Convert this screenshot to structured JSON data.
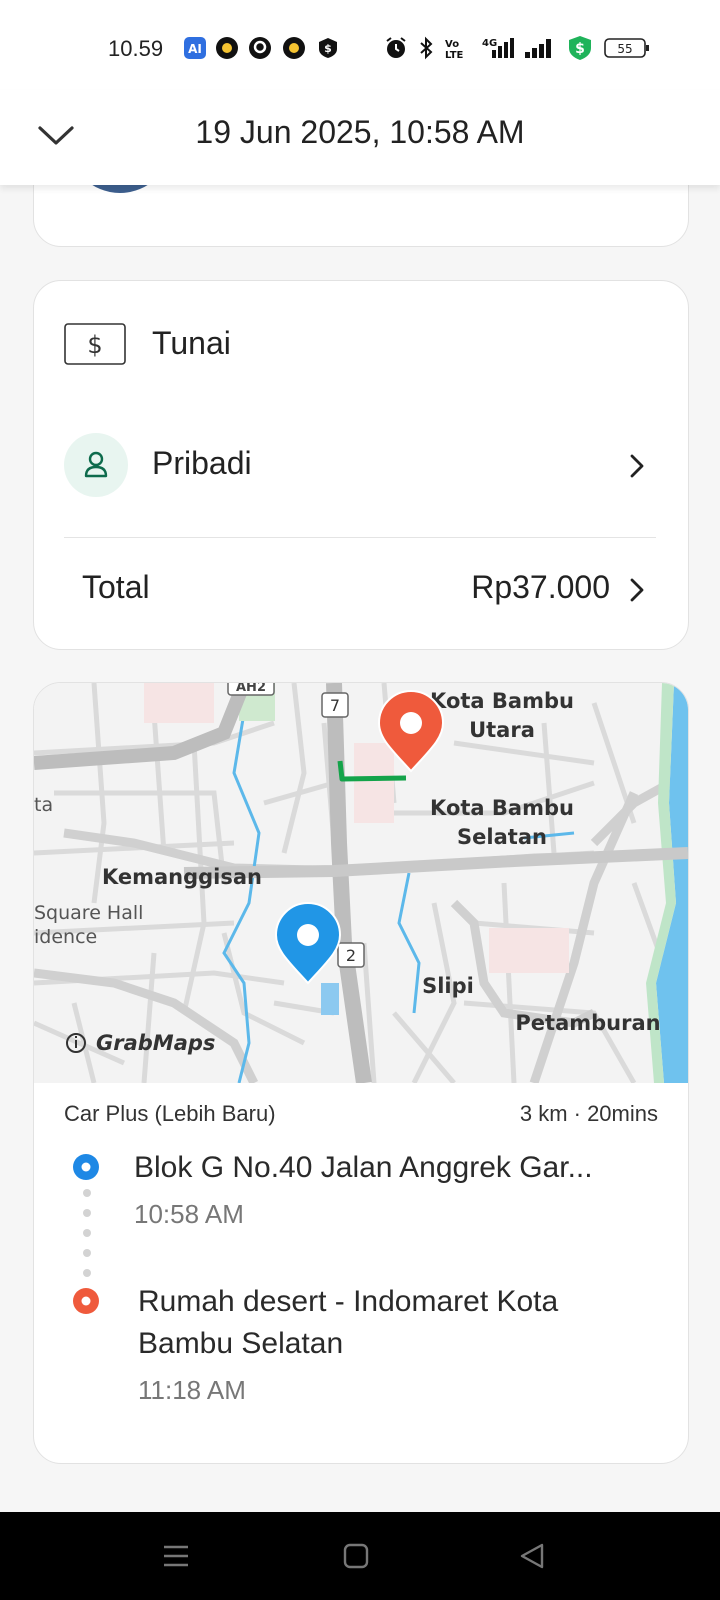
{
  "status_bar": {
    "time": "10.59",
    "battery": "55",
    "network": "4G",
    "carrier_badge": "VoLTE",
    "icons": [
      "ai-icon",
      "grab-food-icon",
      "gojek-icon",
      "grab-food-icon",
      "shield-dollar-icon",
      "alarm-icon",
      "bluetooth-icon",
      "volte-icon",
      "signal-icon",
      "signal-icon",
      "green-shield-dollar-icon",
      "battery-icon"
    ]
  },
  "header": {
    "title": "19 Jun 2025, 10:58 AM",
    "back_icon": "chevron-down-icon"
  },
  "payment": {
    "method_label": "Tunai",
    "method_icon": "cash-icon",
    "profile_label": "Pribadi",
    "profile_icon": "person-icon",
    "total_label": "Total",
    "total_value": "Rp37.000"
  },
  "map": {
    "labels": {
      "kota_bambu_utara": [
        "Kota Bambu",
        "Utara"
      ],
      "kota_bambu_selatan": [
        "Kota Bambu",
        "Selatan"
      ],
      "kemanggisan": "Kemanggisan",
      "square_hall": [
        "Square Hall",
        "idence"
      ],
      "ta": "ta",
      "slipi": "Slipi",
      "petamburan": "Petamburan"
    },
    "road_shields": [
      "7",
      "2",
      "AH2"
    ],
    "attribution": "GrabMaps",
    "pickup_pin_color": "#2196e6",
    "dropoff_pin_color": "#ef5a3c",
    "route_color": "#14a34a"
  },
  "trip": {
    "service": "Car Plus (Lebih Baru)",
    "distance_duration": "3 km · 20mins",
    "pickup": {
      "address": "Blok G No.40 Jalan Anggrek Gar...",
      "time": "10:58 AM"
    },
    "dropoff": {
      "address_line1": "Rumah desert - Indomaret Kota",
      "address_line2": "Bambu Selatan",
      "time": "11:18 AM"
    }
  },
  "nav": {
    "icons": [
      "menu-icon",
      "home-square-icon",
      "back-triangle-icon"
    ]
  }
}
